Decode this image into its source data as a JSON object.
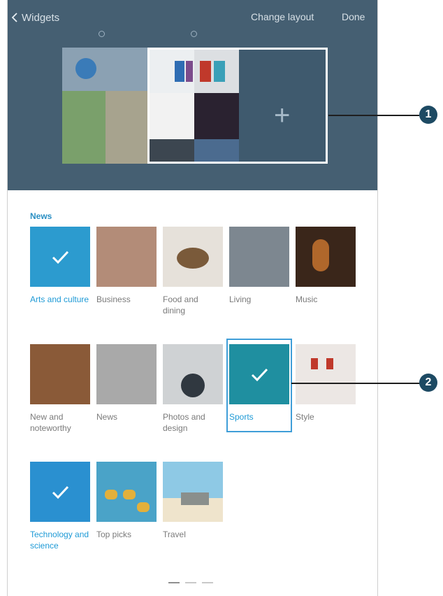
{
  "header": {
    "back_label": "Widgets",
    "change_layout_label": "Change layout",
    "done_label": "Done"
  },
  "section_title": "News",
  "categories": [
    {
      "label": "Arts and culture",
      "selected": true
    },
    {
      "label": "Business",
      "selected": false
    },
    {
      "label": "Food and dining",
      "selected": false
    },
    {
      "label": "Living",
      "selected": false
    },
    {
      "label": "Music",
      "selected": false
    },
    {
      "label": "New and noteworthy",
      "selected": false
    },
    {
      "label": "News",
      "selected": false
    },
    {
      "label": "Photos and design",
      "selected": false
    },
    {
      "label": "Sports",
      "selected": true
    },
    {
      "label": "Style",
      "selected": false
    },
    {
      "label": "Technology and science",
      "selected": true
    },
    {
      "label": "Top picks",
      "selected": false
    },
    {
      "label": "Travel",
      "selected": false
    }
  ],
  "callouts": [
    "1",
    "2"
  ],
  "add_icon": "+",
  "pagination": {
    "pages": 3,
    "current": 1
  }
}
